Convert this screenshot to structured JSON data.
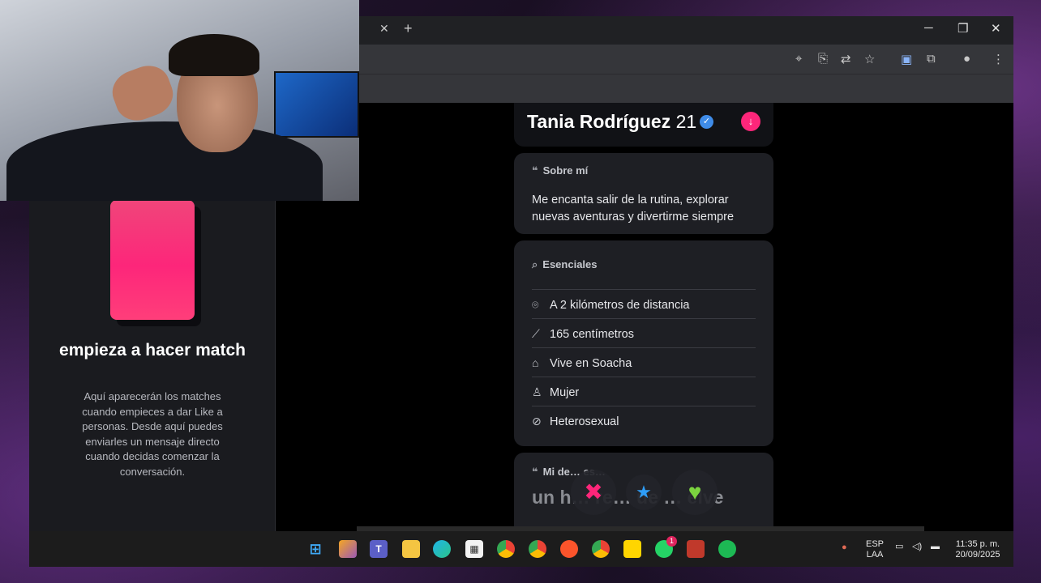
{
  "profile": {
    "name": "Tania Rodríguez",
    "age": "21",
    "about": {
      "heading": "Sobre mí",
      "text": "Me encanta salir de la rutina, explorar nuevas aventuras y divertirme siempre"
    },
    "essentials": {
      "heading": "Esenciales",
      "items": [
        {
          "icon": "location-pin-icon",
          "label": "A 2 kilómetros de distancia"
        },
        {
          "icon": "ruler-icon",
          "label": "165 centímetros"
        },
        {
          "icon": "home-icon",
          "label": "Vive en Soacha"
        },
        {
          "icon": "person-icon",
          "label": "Mujer"
        },
        {
          "icon": "orientation-icon",
          "label": "Heterosexual"
        }
      ]
    },
    "partial_section": {
      "heading": "Mi de… es…",
      "text": "un h… re… ue … elve"
    }
  },
  "match_panel": {
    "title": "empieza a hacer match",
    "description": "Aquí aparecerán los matches cuando empieces a dar Like a personas. Desde aquí puedes enviarles un mensaje directo cuando decidas comenzar la conversación."
  },
  "actions": {
    "nope": "✖",
    "super_like": "★",
    "like": "♥"
  },
  "taskbar": {
    "language_top": "ESP",
    "language_bottom": "LAA",
    "time": "11:35 p. m.",
    "date": "20/09/2025",
    "whatsapp_badge": "1"
  },
  "colors": {
    "accent": "#fd267a",
    "verified": "#3f8ce8",
    "like": "#7bd33f",
    "super_like": "#2e9df7"
  }
}
